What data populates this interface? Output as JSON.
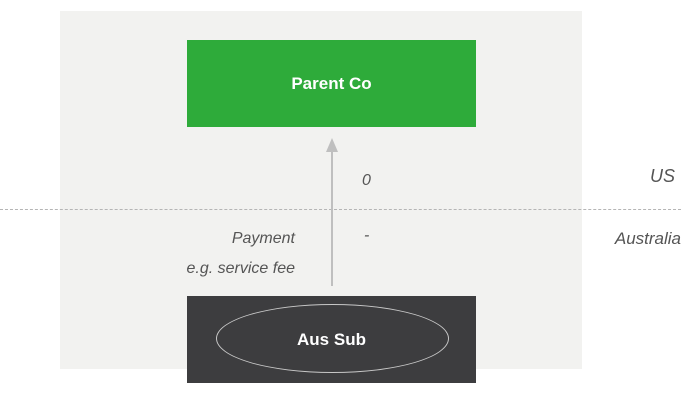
{
  "entities": {
    "parent": {
      "label": "Parent Co",
      "color": "#2eab3a"
    },
    "subsidiary": {
      "label": "Aus Sub",
      "color": "#3d3d3f"
    }
  },
  "flow": {
    "label_line1": "Payment",
    "label_line2": "e.g. service fee",
    "direction": "subsidiary-to-parent"
  },
  "jurisdictions": {
    "upper": {
      "name": "US",
      "value": "0"
    },
    "lower": {
      "name": "Australia",
      "value": "-"
    }
  },
  "colors": {
    "background_panel": "#f2f2f0",
    "arrow": "#bfbfbf",
    "divider": "#b5b5b5",
    "text": "#555555"
  }
}
